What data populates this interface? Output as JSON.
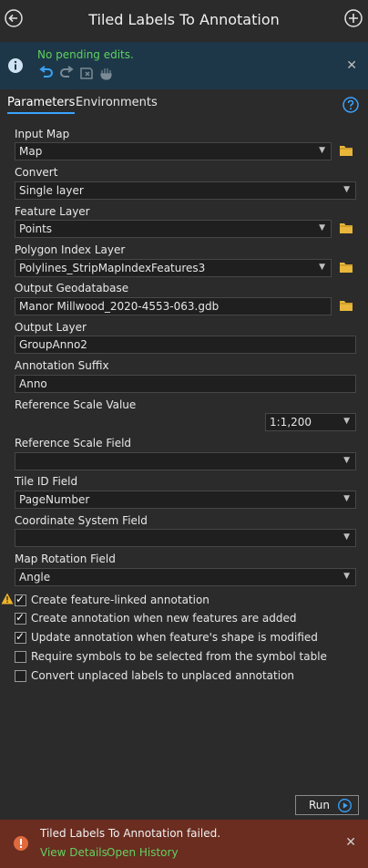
{
  "header": {
    "title": "Tiled Labels To Annotation"
  },
  "banner": {
    "message": "No pending edits.",
    "close_glyph": "✕"
  },
  "tabs": {
    "parameters": "Parameters",
    "environments": "Environments"
  },
  "params": {
    "input_map": {
      "label": "Input Map",
      "value": "Map"
    },
    "convert": {
      "label": "Convert",
      "value": "Single layer"
    },
    "feature_layer": {
      "label": "Feature Layer",
      "value": "Points"
    },
    "polygon_index_layer": {
      "label": "Polygon Index Layer",
      "value": "Polylines_StripMapIndexFeatures3"
    },
    "output_geodatabase": {
      "label": "Output Geodatabase",
      "value": "Manor Millwood_2020-4553-063.gdb"
    },
    "output_layer": {
      "label": "Output Layer",
      "value": "GroupAnno2"
    },
    "annotation_suffix": {
      "label": "Annotation Suffix",
      "value": "Anno"
    },
    "reference_scale_value": {
      "label": "Reference Scale Value",
      "value": "1:1,200"
    },
    "reference_scale_field": {
      "label": "Reference Scale Field",
      "value": ""
    },
    "tile_id_field": {
      "label": "Tile ID Field",
      "value": "PageNumber"
    },
    "coordinate_system_field": {
      "label": "Coordinate System Field",
      "value": ""
    },
    "map_rotation_field": {
      "label": "Map Rotation Field",
      "value": "Angle"
    }
  },
  "checkboxes": [
    {
      "label": "Create feature-linked annotation",
      "checked": true
    },
    {
      "label": "Create annotation when new features are added",
      "checked": true
    },
    {
      "label": "Update annotation when feature's shape is modified",
      "checked": true
    },
    {
      "label": "Require symbols to be selected from the symbol table",
      "checked": false
    },
    {
      "label": "Convert unplaced labels to unplaced annotation",
      "checked": false
    }
  ],
  "run": {
    "label": "Run"
  },
  "footer": {
    "message": "Tiled Labels To Annotation failed.",
    "view_details": "View Details",
    "open_history": "Open History",
    "close_glyph": "✕"
  },
  "colors": {
    "accent": "#3aa3ff",
    "success": "#5fd15f",
    "error_bg": "#6a2d20",
    "folder": "#e8b63a",
    "warning": "#f0b429"
  }
}
